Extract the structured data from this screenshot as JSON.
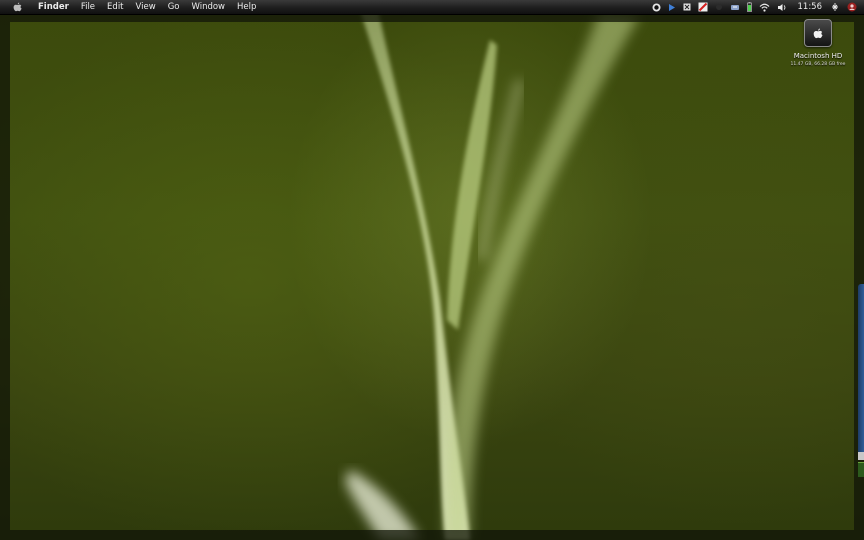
{
  "menubar": {
    "apple_icon": "apple-icon",
    "items": [
      "Finder",
      "File",
      "Edit",
      "View",
      "Go",
      "Window",
      "Help"
    ],
    "clock": "11:56",
    "status_icons": [
      "skype-icon",
      "play-icon",
      "screen-capture-icon",
      "no-entry-icon",
      "activity-icon",
      "sync-icon",
      "battery-icon",
      "wifi-icon",
      "volume-icon",
      "bluetooth-icon",
      "user-icon"
    ]
  },
  "desktop": {
    "drive": {
      "name": "Macintosh HD",
      "info": "11.47 GB, 66.28 GB free"
    }
  },
  "colors": {
    "wallpaper_base": "#3c4a0c",
    "menubar": "#1e1e1e",
    "menubar_text": "#ececec"
  }
}
